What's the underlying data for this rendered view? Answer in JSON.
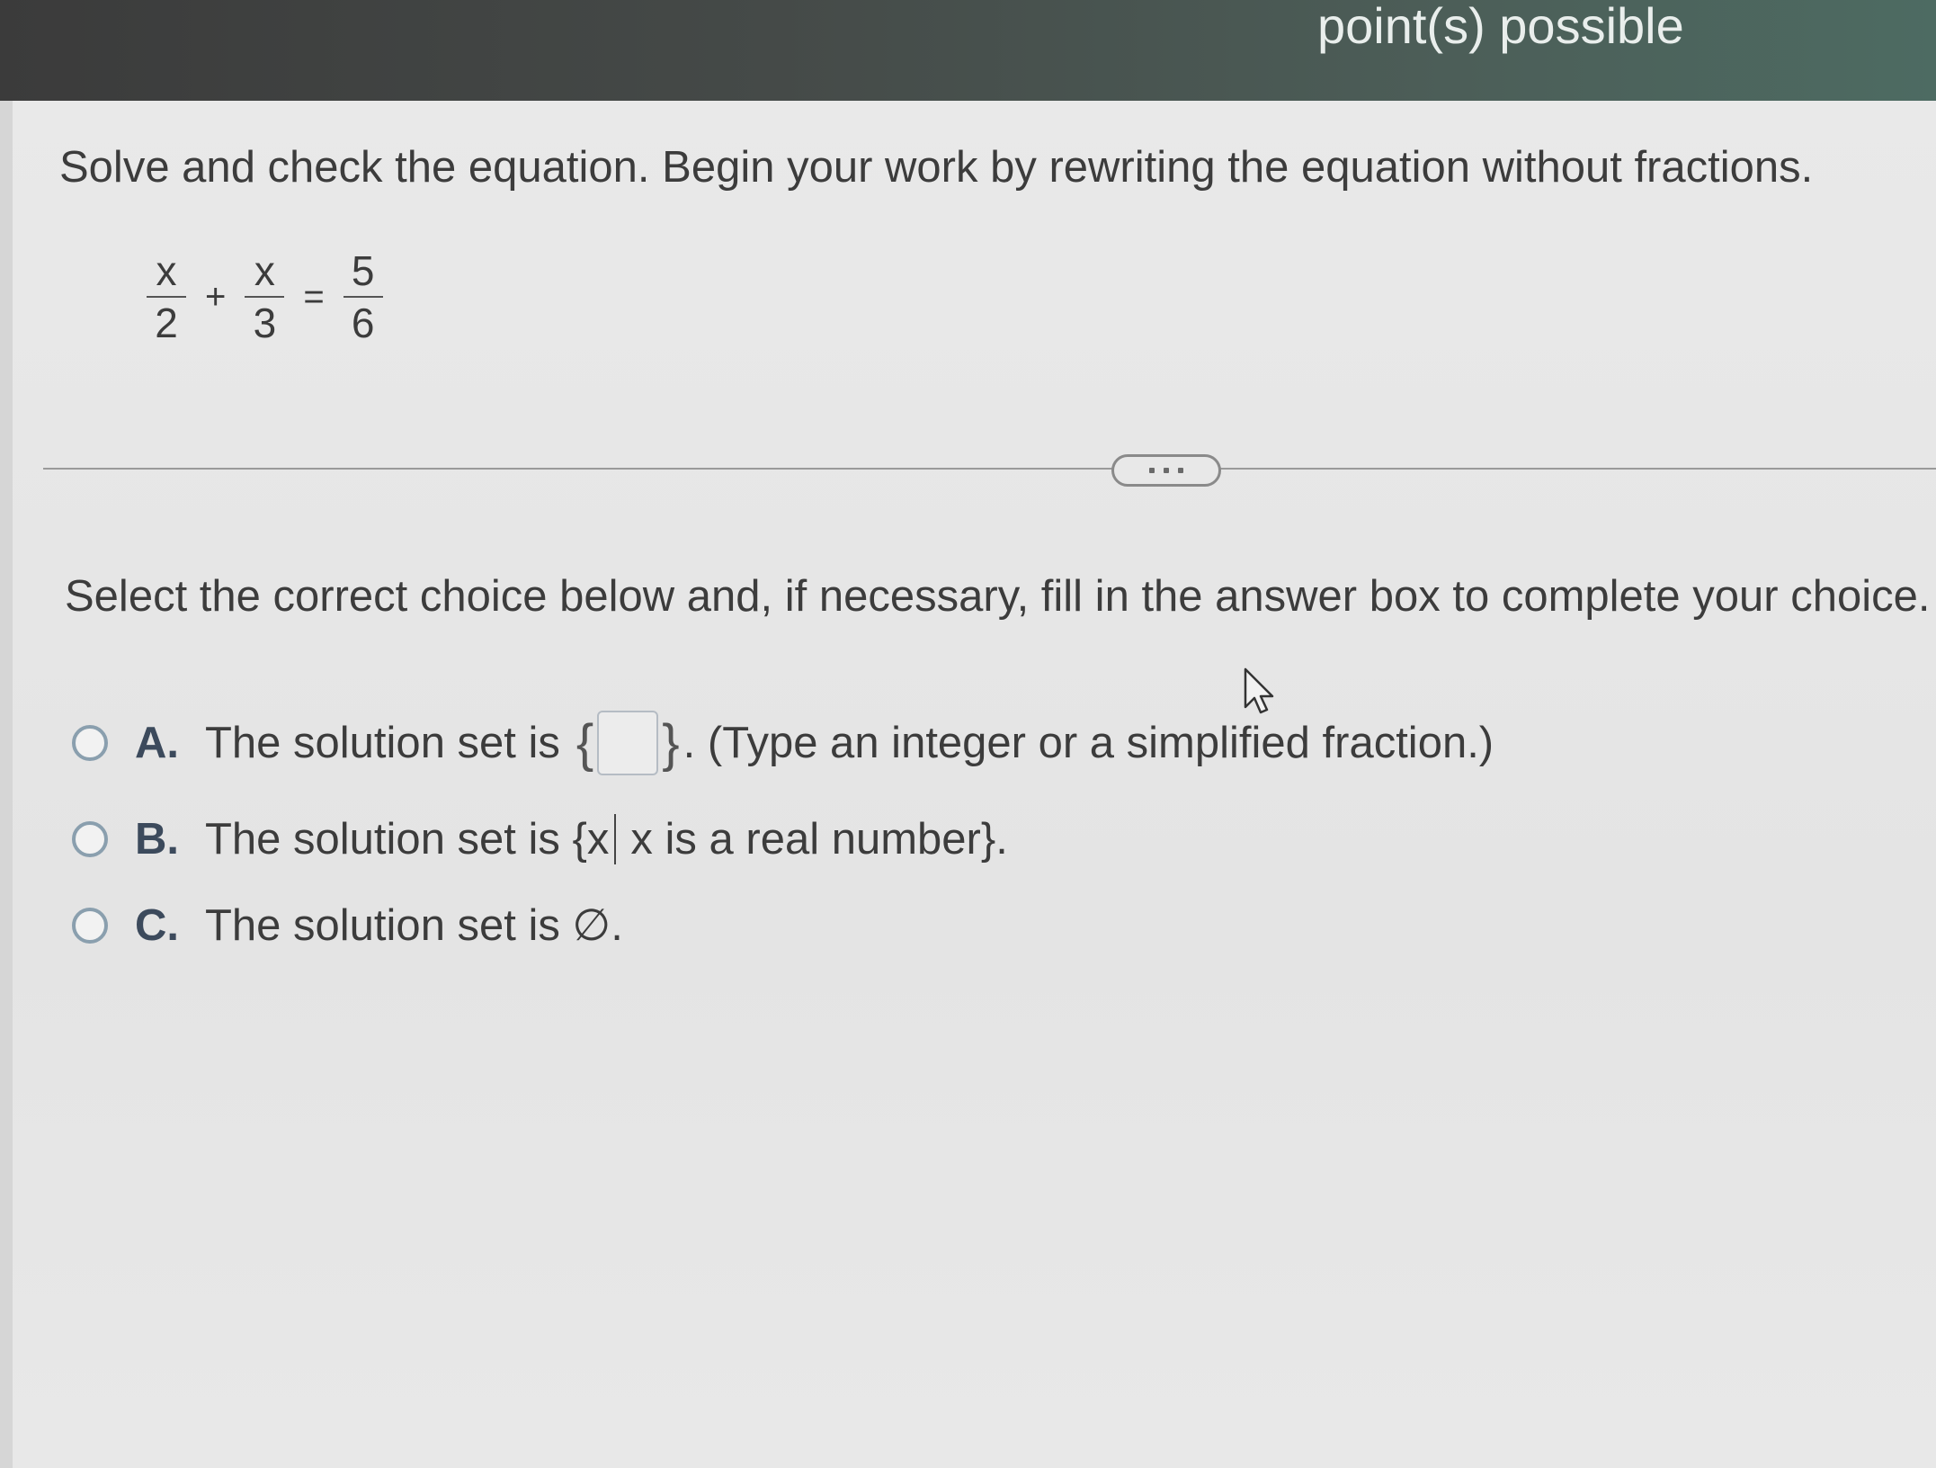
{
  "header": {
    "points_label": "point(s) possible"
  },
  "problem": {
    "instruction": "Solve and check the equation. Begin your work by rewriting the equation without fractions.",
    "equation": {
      "term1": {
        "numerator": "x",
        "denominator": "2"
      },
      "op1": "+",
      "term2": {
        "numerator": "x",
        "denominator": "3"
      },
      "op2": "=",
      "term3": {
        "numerator": "5",
        "denominator": "6"
      }
    }
  },
  "select_prompt": "Select the correct choice below and, if necessary, fill in the answer box to complete your choice.",
  "choices": [
    {
      "letter": "A.",
      "text_before": "The solution set is",
      "brace_open": "{",
      "brace_close": "}",
      "text_after": ". (Type an integer or a simplified fraction.)"
    },
    {
      "letter": "B.",
      "text_before": "The solution set is {x",
      "text_after": "x is a real number}."
    },
    {
      "letter": "C.",
      "text": "The solution set is ∅."
    }
  ],
  "colors": {
    "header_start": "#3b3b3b",
    "header_end": "#4d6b62",
    "radio_border": "#8a9fae",
    "background": "#e6e6e6"
  }
}
